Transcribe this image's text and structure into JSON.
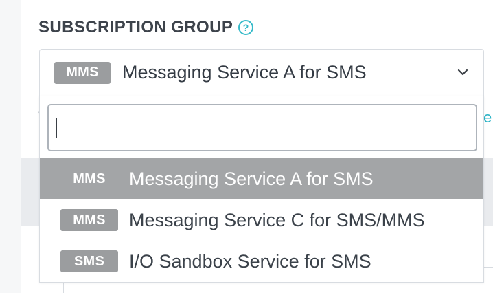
{
  "field": {
    "label": "SUBSCRIPTION GROUP",
    "help_glyph": "?"
  },
  "select": {
    "selected_badge": "MMS",
    "selected_label": "Messaging Service A for SMS",
    "chevron_icon": "chevron-down-icon"
  },
  "search": {
    "value": "",
    "placeholder": ""
  },
  "options": [
    {
      "badge": "MMS",
      "label": "Messaging Service A for SMS",
      "highlighted": true
    },
    {
      "badge": "MMS",
      "label": "Messaging Service C for SMS/MMS",
      "highlighted": false
    },
    {
      "badge": "SMS",
      "label": "I/O Sandbox Service for SMS",
      "highlighted": false
    }
  ],
  "colors": {
    "accent": "#35bac9",
    "badge_bg": "#9b9d9f",
    "highlight_bg": "#a3a5a7",
    "border": "#d8dce1",
    "text": "#343b44"
  }
}
